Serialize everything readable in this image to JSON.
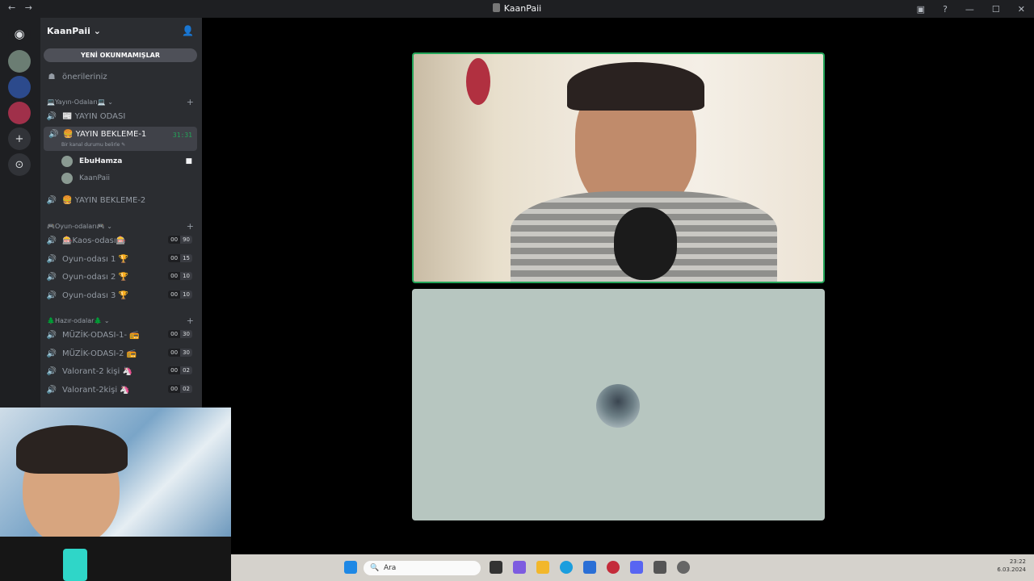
{
  "titlebar": {
    "back": "←",
    "forward": "→",
    "title": "KaanPaii",
    "help": "?",
    "minimize": "—",
    "maximize": "☐",
    "close": "✕"
  },
  "server": {
    "name": "KaanPaii",
    "unread_banner": "YENİ OKUNMAMIŞLAR",
    "suggestions": "önerileriniz"
  },
  "categories": [
    {
      "label": "💻Yayın-Odaları💻",
      "channels": [
        {
          "name": "📰 YAYIN ODASI"
        },
        {
          "name": "🍔 YAYIN BEKLEME-1",
          "time": "31:31",
          "status": "Bir kanal durumu belirle ✎"
        },
        {
          "name": "🍔 YAYIN BEKLEME-2"
        }
      ],
      "users": [
        "EbuHamza",
        "KaanPaii"
      ]
    },
    {
      "label": "🎮Oyun-odaları🎮",
      "channels": [
        {
          "name": "🎰Kaos-odası🎰",
          "count": "00",
          "limit": "90"
        },
        {
          "name": "Oyun-odası 1 🏆",
          "count": "00",
          "limit": "15"
        },
        {
          "name": "Oyun-odası 2 🏆",
          "count": "00",
          "limit": "10"
        },
        {
          "name": "Oyun-odası 3 🏆",
          "count": "00",
          "limit": "10"
        }
      ]
    },
    {
      "label": "🌲Hazır-odalar🌲",
      "channels": [
        {
          "name": "MÜZİK-ODASI-1- 📻",
          "count": "00",
          "limit": "30"
        },
        {
          "name": "MÜZİK-ODASI-2 📻",
          "count": "00",
          "limit": "30"
        },
        {
          "name": "Valorant-2 kişi 🦄",
          "count": "00",
          "limit": "02"
        },
        {
          "name": "Valorant-2kişi 🦄",
          "count": "00",
          "limit": "02"
        }
      ]
    }
  ],
  "taskbar": {
    "search_placeholder": "Ara",
    "time": "23:22",
    "date": "6.03.2024"
  },
  "colors": {
    "speaking": "#23a559",
    "sidebar": "#2b2d31",
    "server_rail": "#1e1f22"
  }
}
